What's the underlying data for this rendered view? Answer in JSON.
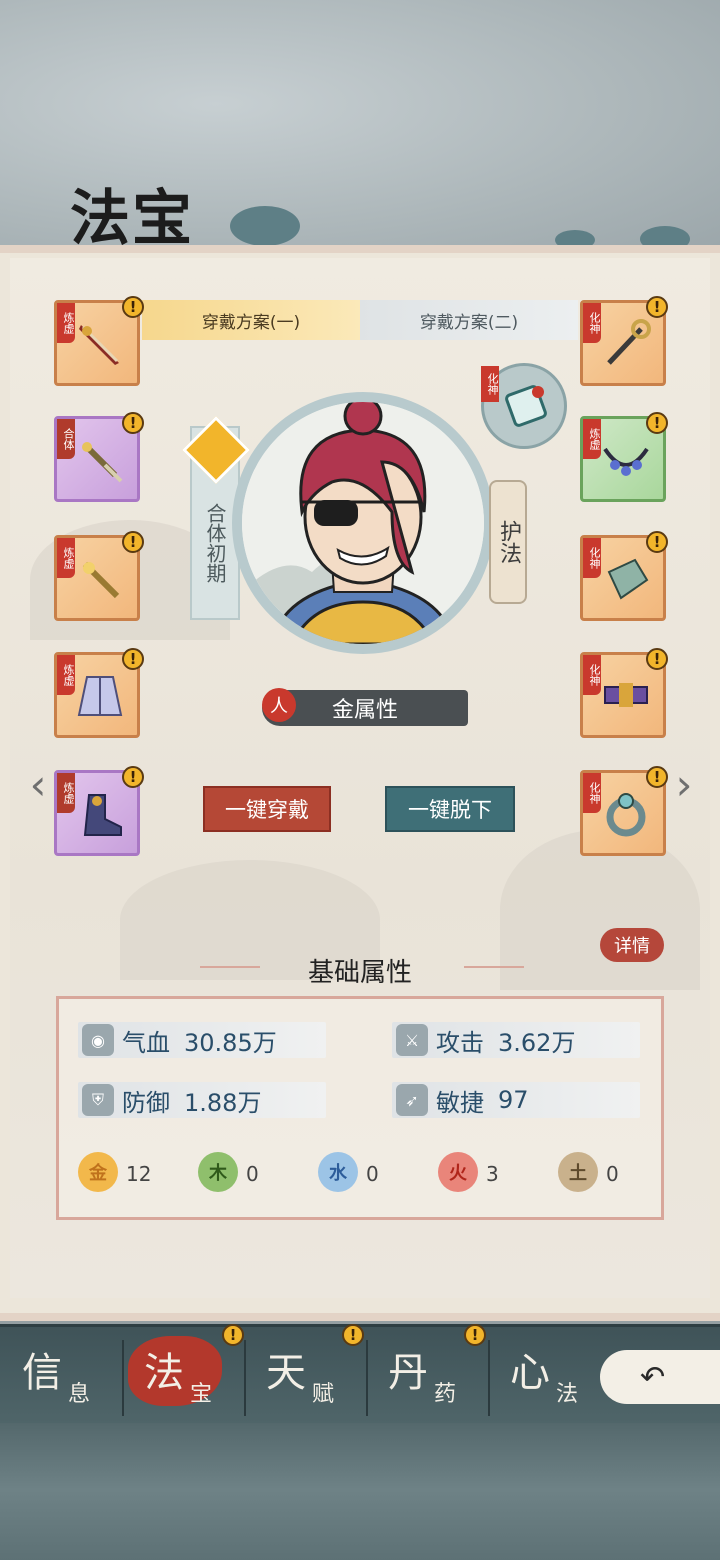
{
  "header": {
    "title": "法宝"
  },
  "tabs": [
    {
      "label": "穿戴方案(一)",
      "active": true
    },
    {
      "label": "穿戴方案(二)",
      "active": false
    }
  ],
  "left_slots": [
    {
      "tag": "炼虚",
      "rarity": "orange",
      "item": "sword-icon",
      "alert": "!"
    },
    {
      "tag": "合体",
      "rarity": "purple",
      "item": "dagger-icon",
      "alert": "!"
    },
    {
      "tag": "炼虚",
      "rarity": "orange",
      "item": "dagger-icon",
      "alert": "!"
    },
    {
      "tag": "炼虚",
      "rarity": "orange",
      "item": "robe-icon",
      "alert": "!"
    },
    {
      "tag": "炼虚",
      "rarity": "purple",
      "item": "boots-icon",
      "alert": "!"
    }
  ],
  "right_slots": [
    {
      "tag": "化神",
      "rarity": "orange",
      "item": "staff-icon",
      "alert": "!"
    },
    {
      "tag": "炼虚",
      "rarity": "green",
      "item": "necklace-icon",
      "alert": "!"
    },
    {
      "tag": "化神",
      "rarity": "orange",
      "item": "bracer-icon",
      "alert": "!"
    },
    {
      "tag": "化神",
      "rarity": "orange",
      "item": "belt-icon",
      "alert": "!"
    },
    {
      "tag": "化神",
      "rarity": "orange",
      "item": "ring-icon",
      "alert": "!"
    }
  ],
  "character": {
    "realm": "合体初期",
    "guardian_label": "护法",
    "amulet_tag": "化神",
    "element_icon": "人",
    "element": "金属性"
  },
  "actions": {
    "equip_all": "一键穿戴",
    "unequip_all": "一键脱下"
  },
  "attributes": {
    "title": "基础属性",
    "detail_label": "详情",
    "stats": [
      {
        "name": "气血",
        "value": "30.85万",
        "icon": "blood-drop-icon"
      },
      {
        "name": "攻击",
        "value": "3.62万",
        "icon": "attack-icon"
      },
      {
        "name": "防御",
        "value": "1.88万",
        "icon": "shield-icon"
      },
      {
        "name": "敏捷",
        "value": "97",
        "icon": "wing-icon"
      }
    ],
    "elements": [
      {
        "glyph": "金",
        "value": "12",
        "color": "#f2b84b"
      },
      {
        "glyph": "木",
        "value": "0",
        "color": "#8fbf6c"
      },
      {
        "glyph": "水",
        "value": "0",
        "color": "#9cc4e6"
      },
      {
        "glyph": "火",
        "value": "3",
        "color": "#e9857a"
      },
      {
        "glyph": "土",
        "value": "0",
        "color": "#c9b18c"
      }
    ]
  },
  "nav": [
    {
      "big": "信",
      "small": "息",
      "alert": ""
    },
    {
      "big": "法",
      "small": "宝",
      "alert": "!"
    },
    {
      "big": "天",
      "small": "赋",
      "alert": "!"
    },
    {
      "big": "丹",
      "small": "药",
      "alert": "!"
    },
    {
      "big": "心",
      "small": "法",
      "alert": ""
    }
  ]
}
